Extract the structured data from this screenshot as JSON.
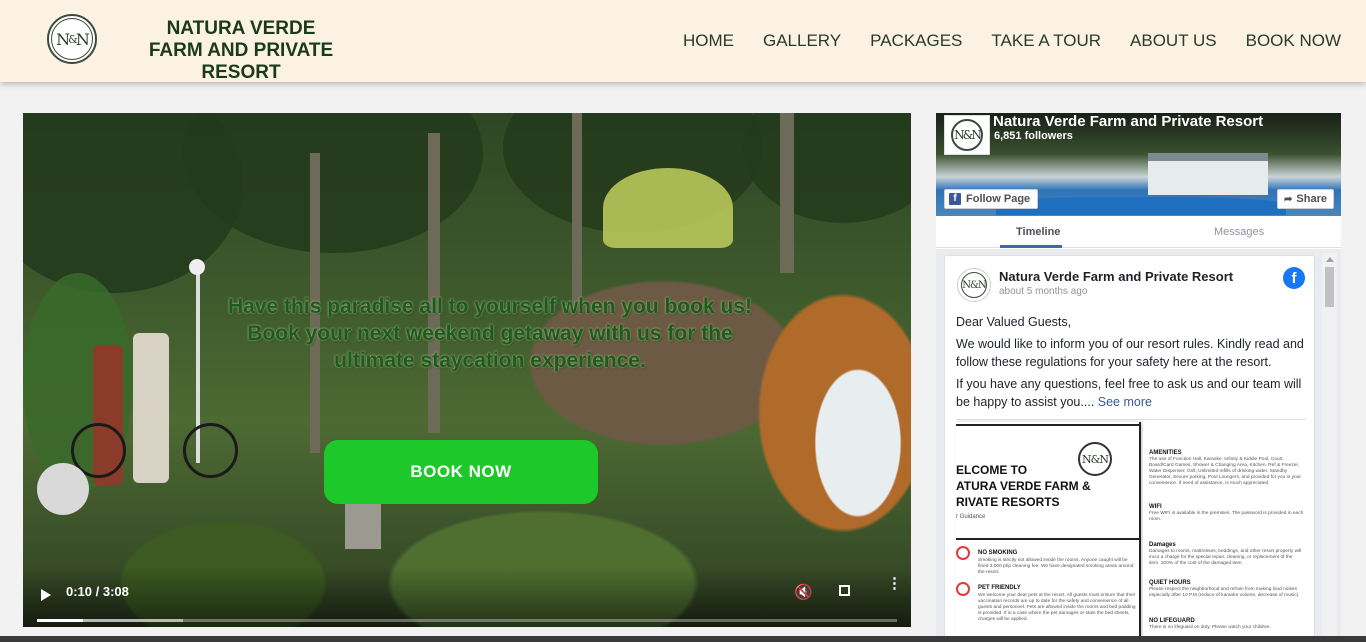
{
  "header": {
    "logo_text": "N",
    "brand_line1": "NATURA VERDE",
    "brand_line2": "FARM AND PRIVATE RESORT",
    "nav": [
      "HOME",
      "GALLERY",
      "PACKAGES",
      "TAKE A TOUR",
      "ABOUT US",
      "BOOK NOW"
    ]
  },
  "hero": {
    "headline_line1": "Have this paradise all to yourself when you book us!",
    "headline_line2": "Book your next weekend getaway with us for the ultimate staycation experience.",
    "cta_label": "BOOK NOW",
    "video_time": "0:10 / 3:08",
    "progress_fraction": 0.054
  },
  "facebook": {
    "page_name": "Natura Verde Farm and Private Resort",
    "followers": "6,851 followers",
    "follow_label": "Follow Page",
    "share_label": "Share",
    "tabs": [
      "Timeline",
      "Messages"
    ],
    "post": {
      "author": "Natura Verde Farm and Private Resort",
      "time": "about 5 months ago",
      "greeting": "Dear Valued Guests,",
      "para1": "We would like to inform you of our resort rules. Kindly read and follow these regulations for your safety here at the resort.",
      "para2": "If you have any questions, feel free to ask us and our team will be happy to assist you....",
      "see_more": "See more"
    },
    "document": {
      "welcome_l1": "ELCOME TO",
      "welcome_l2": "ATURA VERDE FARM &",
      "welcome_l3": "RIVATE RESORTS",
      "guidance": "r Guidance",
      "no_smoking": "NO SMOKING",
      "no_smoking_text": "Smoking is strictly not allowed inside the rooms. Anyone caught will be fined 3,000 php cleaning fee. We have designated smoking areas around the resort.",
      "pet_friendly": "PET FRIENDLY",
      "pet_text": "We welcome your dear pets at the resort. All guests must ensure that their vaccination records are up to date for the safety and convenience of all guests and personnel. Pets are allowed inside the rooms and bed padding is provided. If in a case where the pet damages or stain the bed sheets, charges will be applied.",
      "amenities": "AMENITIES",
      "amenities_text": "The use of Function Hall, Karaoke, Infinity & Kiddie Pool, Court, Board/Card Games, Shower & Changing Area, Kitchen, Ref & Freezer, Water Dispenser, Grill, Unlimited refills of drinking water, Standby Generator, Secure parking, Pool Loungers, and provided for you in your convenience. If need of assistance, is much appreciated.",
      "wifi": "WIFI",
      "wifi_text": "Free WIFI is available in the premises. The password is provided in each room.",
      "damages": "Damages",
      "damages_text": "Damages to rooms, mattresses, beddings, and other resort property will incur a charge for the special repair, cleaning, or replacement of the item. 100% of the cost of the damaged item.",
      "quiet": "QUIET HOURS",
      "quiet_text": "Please respect the neighborhood and refrain from making loud noises especially after 10 P.M (reduce of karaoke volume, decrease of music).",
      "lifeguard": "NO LIFEGUARD",
      "lifeguard_text": "There is no lifeguard on duty. Please watch your children."
    }
  }
}
